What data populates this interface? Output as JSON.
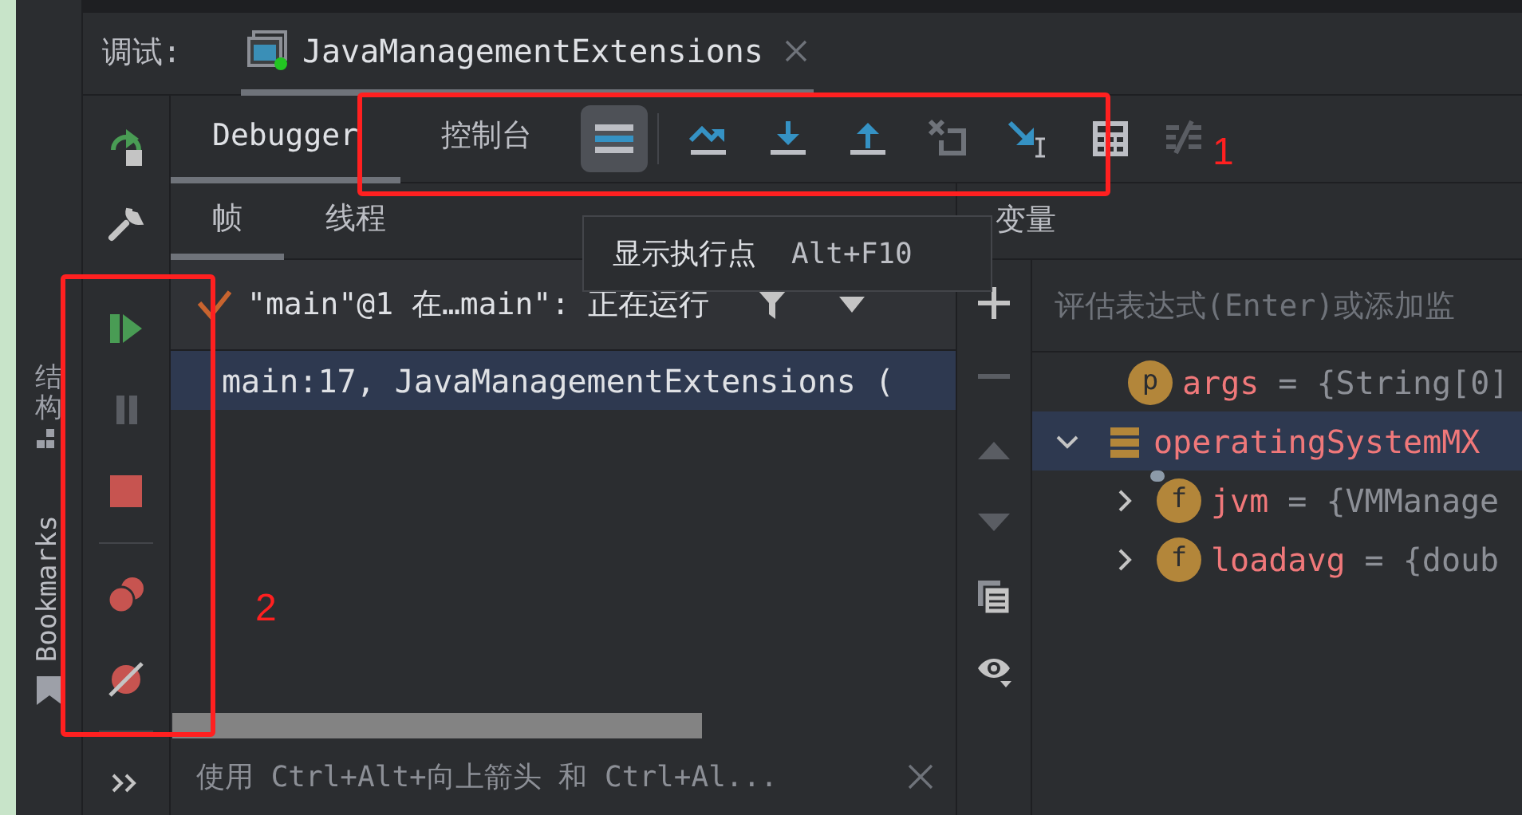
{
  "debug_header": {
    "label": "调试:",
    "session_tab": {
      "title": "JavaManagementExtensions",
      "selected": true
    }
  },
  "tabs": [
    {
      "label": "Debugger",
      "selected": true
    },
    {
      "label": "控制台",
      "selected": false
    }
  ],
  "frame_tabs": [
    {
      "label": "帧",
      "selected": true
    },
    {
      "label": "线程",
      "selected": false
    }
  ],
  "variables_title": "变量",
  "tooltip": {
    "text": "显示执行点",
    "shortcut": "Alt+F10"
  },
  "side_tools": [
    {
      "label": "结构",
      "kind": "structure"
    },
    {
      "label": "Bookmarks",
      "kind": "bookmarks"
    }
  ],
  "thread": {
    "label": "\"main\"@1 在…main\": 正在运行"
  },
  "frames": [
    {
      "text": "main:17, JavaManagementExtensions (",
      "selected": true
    }
  ],
  "hint": {
    "text": "使用 Ctrl+Alt+向上箭头 和 Ctrl+Al..."
  },
  "eval_field": {
    "placeholder": "评估表达式(Enter)或添加监"
  },
  "variables": [
    {
      "kind": "param",
      "badge": "p",
      "name": "args",
      "value": "= {String[0]",
      "selected": false
    },
    {
      "kind": "static",
      "name": "operatingSystemMX",
      "selected": true,
      "expanded": true,
      "children": [
        {
          "kind": "field",
          "badge": "f",
          "name": "jvm",
          "value": "= {VMManage",
          "selected": false,
          "expanded": false,
          "pinned": true
        },
        {
          "kind": "field",
          "badge": "f",
          "name": "loadavg",
          "value": "= {doub",
          "selected": false,
          "expanded": false,
          "pinned": false
        }
      ]
    }
  ],
  "annotations": [
    {
      "label": "1"
    },
    {
      "label": "2"
    }
  ]
}
